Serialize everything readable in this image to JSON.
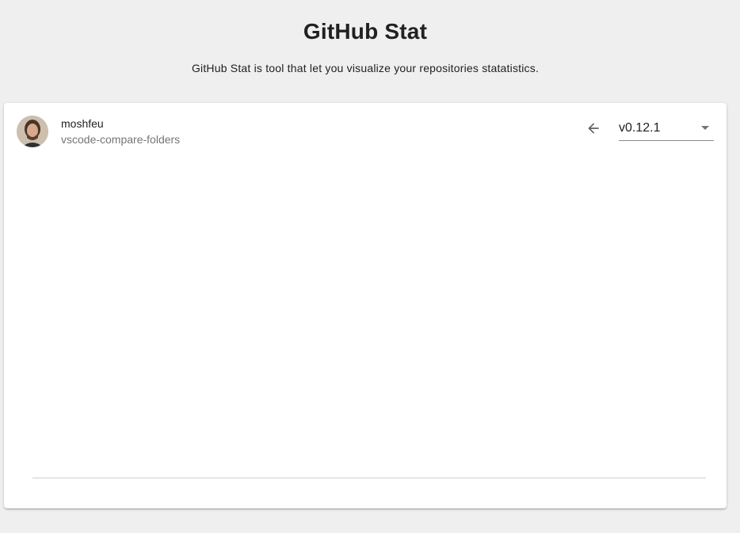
{
  "header": {
    "title": "GitHub Stat",
    "subtitle": "GitHub Stat is tool that let you visualize your repositories statatistics."
  },
  "repo": {
    "owner": "moshfeu",
    "name": "vscode-compare-folders",
    "avatar_icon": "user-avatar"
  },
  "controls": {
    "back_icon": "arrow-left-icon",
    "version_selected": "v0.12.1",
    "dropdown_icon": "chevron-down-icon"
  },
  "colors": {
    "background": "#efefef",
    "card": "#ffffff",
    "primary_text": "#212121",
    "secondary_text": "#757575"
  }
}
